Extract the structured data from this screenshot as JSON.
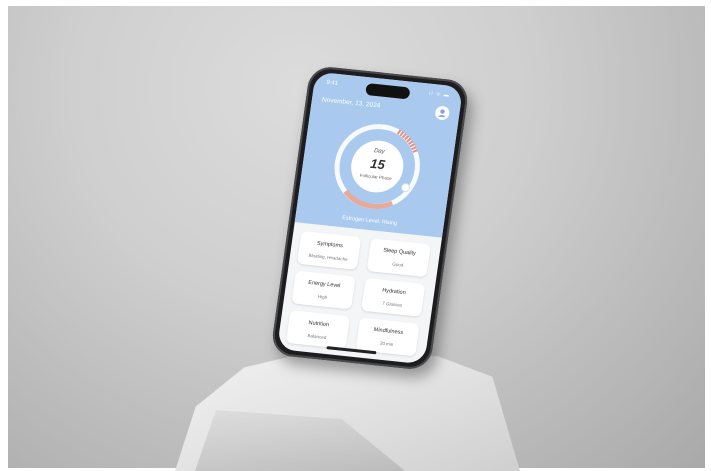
{
  "status_bar": {
    "time": "9:41",
    "icons": "ıl ᯤ ▬"
  },
  "header": {
    "date": "November, 13, 2024",
    "profile_icon": "person-icon"
  },
  "cycle": {
    "day_label": "Day",
    "day_number": "15",
    "phase": "Follicular Phase",
    "estrogen": "Estrogen Level: Rising",
    "colors": {
      "track": "#ffffff",
      "accent": "#e58c84",
      "segment": "#e7a998"
    }
  },
  "cards": [
    {
      "title": "Symptoms",
      "value": "Bloating, Headache"
    },
    {
      "title": "Sleep Quality",
      "value": "Good"
    },
    {
      "title": "Energy Level",
      "value": "High"
    },
    {
      "title": "Hydration",
      "value": "7 Glasses"
    },
    {
      "title": "Nutrition",
      "value": "Balanced"
    },
    {
      "title": "Mindfulness",
      "value": "20 min"
    }
  ]
}
